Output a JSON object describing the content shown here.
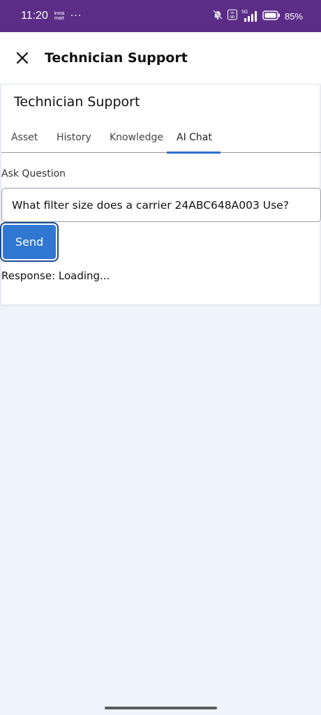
{
  "status_bar": {
    "time": "11:20",
    "notification_text": "insta mart",
    "more_dots": "···",
    "network": "5G",
    "battery": "85%"
  },
  "header": {
    "title": "Technician Support",
    "close_icon": "close-icon"
  },
  "card": {
    "title": "Technician Support",
    "tabs": [
      {
        "label": "Asset",
        "active": false
      },
      {
        "label": "History",
        "active": false
      },
      {
        "label": "Knowledge",
        "active": false
      },
      {
        "label": "AI Chat",
        "active": true
      }
    ],
    "ask_label": "Ask Question",
    "question_value": "What filter size does a carrier 24ABC648A003 Use?",
    "send_label": "Send",
    "response_text": "Response: Loading..."
  },
  "colors": {
    "status_bar": "#5b2d86",
    "accent": "#2b6fce",
    "send_button": "#3077d1",
    "background": "#eef3fc"
  }
}
